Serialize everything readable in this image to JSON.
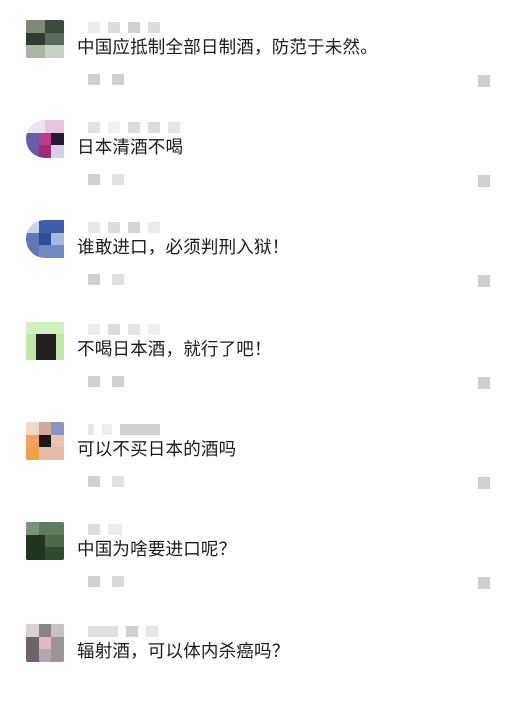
{
  "comments": [
    {
      "text": "中国应抵制全部日制酒，防范于未然。"
    },
    {
      "text": "日本清酒不喝"
    },
    {
      "text": "谁敢进口，必须判刑入狱！"
    },
    {
      "text": "不喝日本酒，就行了吧！"
    },
    {
      "text": "可以不买日本的酒吗"
    },
    {
      "text": "中国为啥要进口呢？"
    },
    {
      "text": "辐射酒，可以体内杀癌吗？"
    }
  ]
}
